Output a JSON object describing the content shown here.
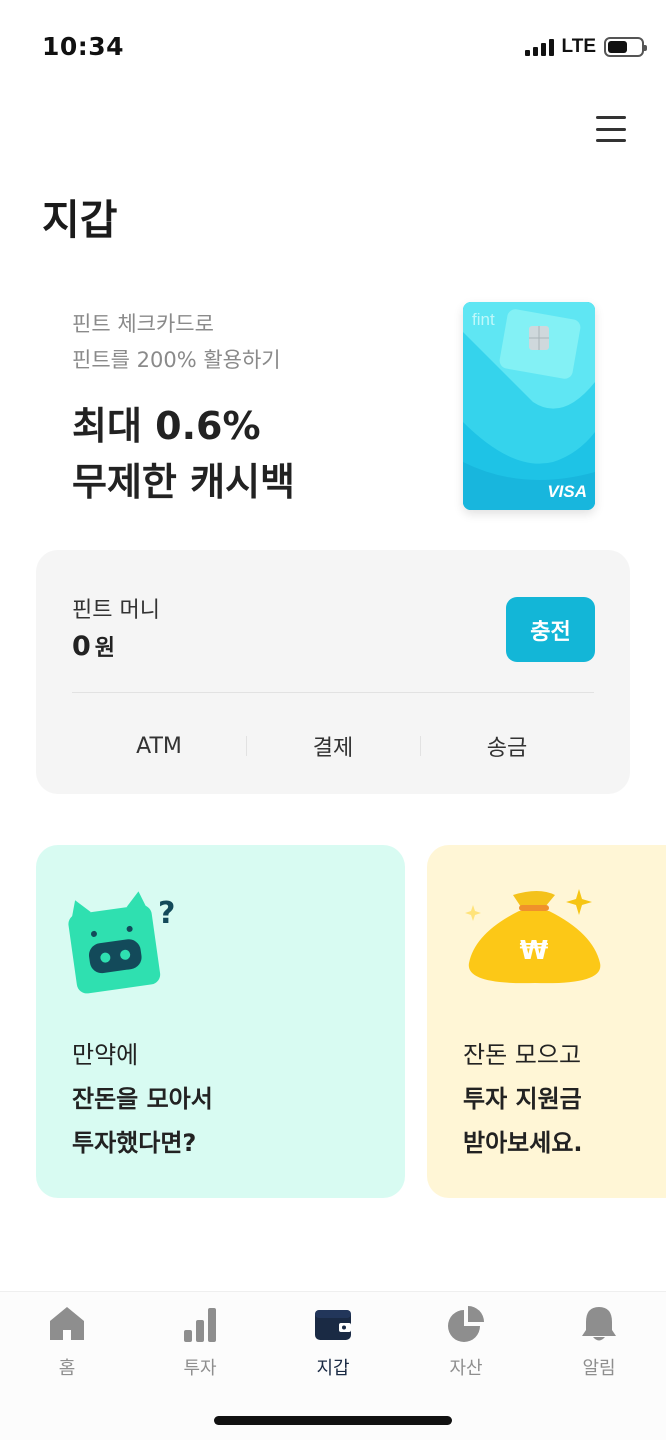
{
  "status_bar": {
    "time": "10:34",
    "network": "LTE",
    "signal_bars": 4,
    "battery_level": 0.6
  },
  "header": {
    "menu_icon": "hamburger-icon",
    "title": "지갑"
  },
  "promo": {
    "line1": "핀트 체크카드로",
    "line2": "핀트를 200% 활용하기",
    "headline1": "최대 0.6%",
    "headline2": "무제한 캐시백",
    "card": {
      "brand": "fint",
      "network": "VISA",
      "color_primary": "#35d3ec",
      "color_secondary": "#6ef0f4"
    }
  },
  "fint_money": {
    "label": "핀트 머니",
    "amount": "0",
    "unit": "원",
    "charge_label": "충전",
    "actions": [
      "ATM",
      "결제",
      "송금"
    ]
  },
  "feature_cards": [
    {
      "line1": "만약에",
      "line2": "잔돈을 모아서",
      "line3": "투자했다면?",
      "icon": "piggy-question-icon",
      "background": "#d8fbf2"
    },
    {
      "line1": "잔돈 모으고",
      "line2": "투자 지원금",
      "line3": "받아보세요.",
      "icon": "money-bag-icon",
      "background": "#fff6d6"
    }
  ],
  "bottom_nav": {
    "items": [
      {
        "label": "홈",
        "icon": "home-icon",
        "active": false
      },
      {
        "label": "투자",
        "icon": "bar-chart-icon",
        "active": false
      },
      {
        "label": "지갑",
        "icon": "wallet-icon",
        "active": true
      },
      {
        "label": "자산",
        "icon": "pie-chart-icon",
        "active": false
      },
      {
        "label": "알림",
        "icon": "bell-icon",
        "active": false
      }
    ]
  },
  "colors": {
    "accent": "#13b6d7",
    "nav_active": "#1a2a44",
    "nav_inactive": "#8e8e8e",
    "panel": "#f5f5f5"
  }
}
